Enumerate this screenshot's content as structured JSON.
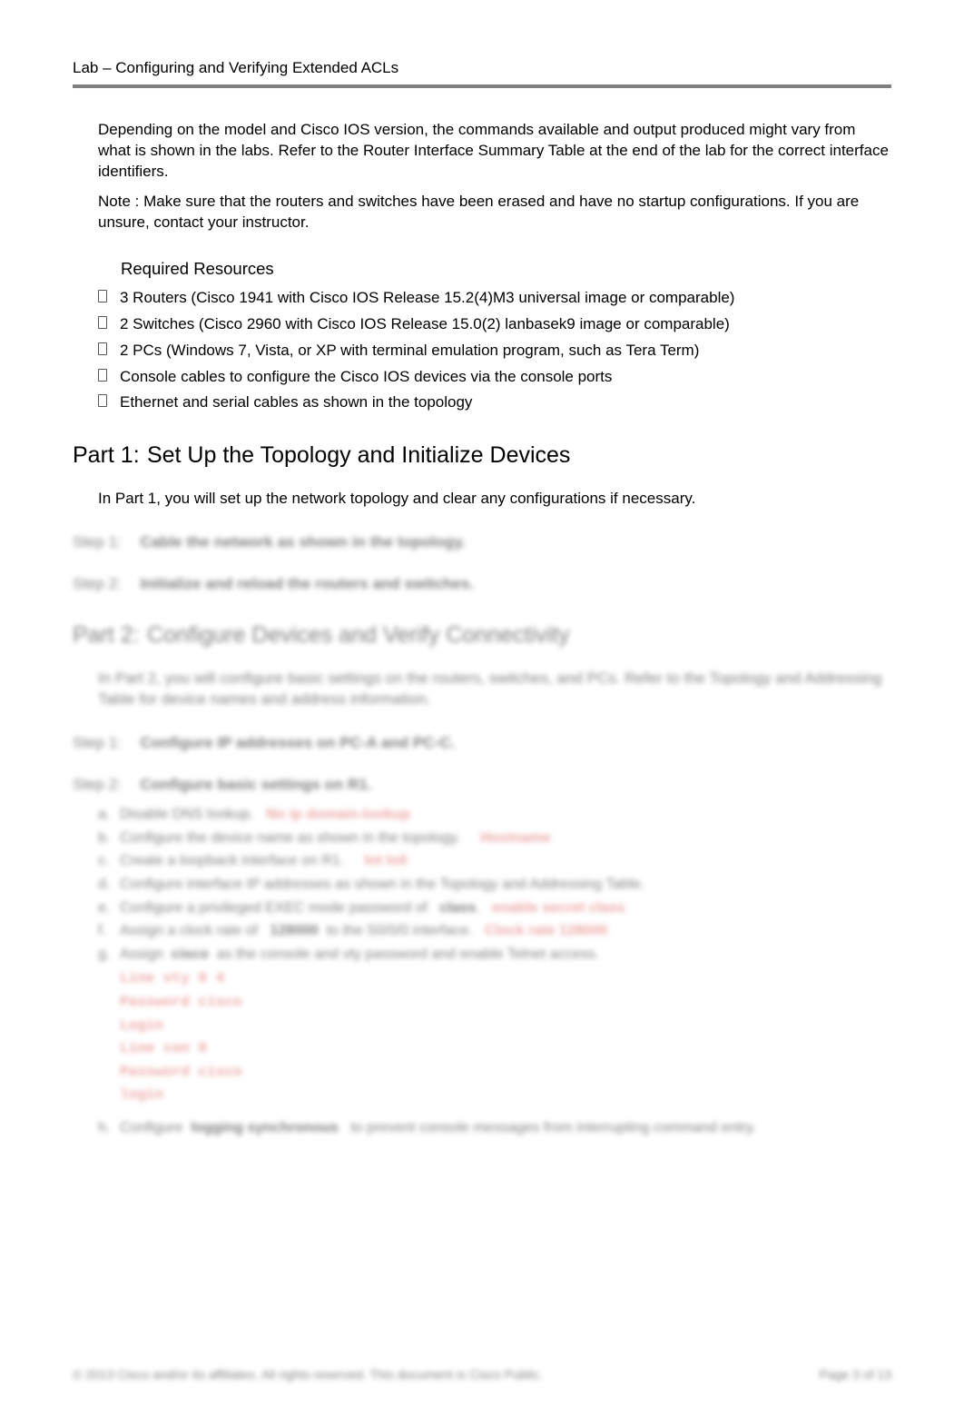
{
  "header": {
    "title": "Lab – Configuring and Verifying Extended ACLs"
  },
  "intro": {
    "para1": "Depending on the model and Cisco IOS version, the commands available and output produced might vary from what is shown in the labs. Refer to the Router Interface Summary Table at the end of the lab for the correct interface identifiers.",
    "para2": "Note : Make sure that the routers and switches have been erased and have no startup configurations. If you are unsure, contact your instructor."
  },
  "resources": {
    "heading": "Required Resources",
    "items": [
      "3 Routers (Cisco 1941 with Cisco IOS Release 15.2(4)M3 universal image or comparable)",
      "2 Switches (Cisco 2960 with Cisco IOS Release 15.0(2) lanbasek9 image or comparable)",
      "2 PCs (Windows 7, Vista, or XP with terminal emulation program, such as Tera Term)",
      "Console cables to configure the Cisco IOS devices via the console ports",
      "Ethernet and serial cables as shown in the topology"
    ]
  },
  "part1": {
    "num": "Part 1:",
    "title": "Set Up the Topology and Initialize Devices",
    "intro": "In Part 1, you will set up the network topology and clear any configurations if necessary.",
    "step1_label": "Step 1:",
    "step1_text": "Cable the network as shown in the topology.",
    "step2_label": "Step 2:",
    "step2_text": "Initialize and reload the routers and switches."
  },
  "part2": {
    "num": "Part 2:",
    "title": "Configure Devices and Verify Connectivity",
    "intro": "In Part 2, you will configure basic settings on the routers, switches, and PCs. Refer to the Topology and Addressing Table for device names and address information.",
    "step1_label": "Step 1:",
    "step1_text": "Configure IP addresses on PC-A and PC-C.",
    "step2_label": "Step 2:",
    "step2_text": "Configure basic settings on R1.",
    "items": {
      "a_text": "Disable DNS lookup.",
      "a_red": "No ip domain-lookup",
      "b_text": "Configure the device name as shown in the topology.",
      "b_red": "Hostname",
      "c_text": "Create a loopback interface on R1.",
      "c_red": "Int lo0",
      "d_text": "Configure interface IP addresses as shown in the Topology and Addressing Table.",
      "e_text": "Configure a privileged EXEC mode password of",
      "e_mid": "class",
      "e_red": "enable secret class",
      "f_text": "Assign a clock rate of",
      "f_mid": "128000",
      "f_end": "to the S0/0/0 interface.",
      "f_red": "Clock rate 128000",
      "g_text": "Assign",
      "g_mid": "cisco",
      "g_end": "as the console and vty password and enable Telnet access.",
      "h_text": "Configure",
      "h_mid": "logging synchronous",
      "h_end": "to prevent console messages from interrupting command entry."
    },
    "code": {
      "l1": "Line vty 0 4",
      "l2": "Password cisco",
      "l3": "Login",
      "l4": "Line con 0",
      "l5": "Password cisco",
      "l6": "login"
    }
  },
  "footer": {
    "copyright": "© 2013 Cisco and/or its affiliates. All rights reserved. This document is Cisco Public.",
    "page": "Page 3 of 13"
  }
}
